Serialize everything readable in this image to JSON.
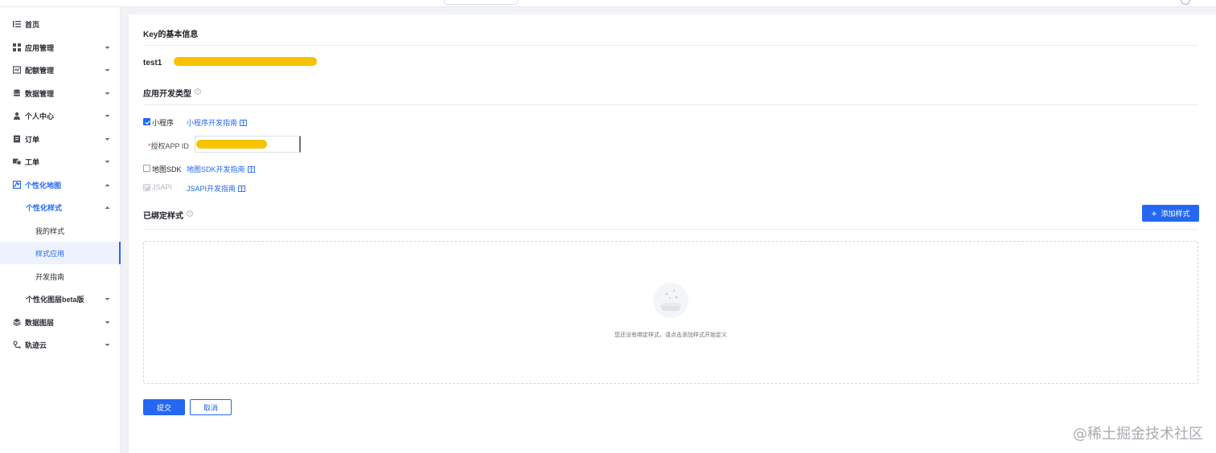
{
  "sidebar": {
    "items": [
      {
        "label": "首页",
        "icon": "list-icon"
      },
      {
        "label": "应用管理",
        "icon": "grid-icon"
      },
      {
        "label": "配额管理",
        "icon": "quota-icon"
      },
      {
        "label": "数据管理",
        "icon": "database-icon"
      },
      {
        "label": "个人中心",
        "icon": "user-icon"
      },
      {
        "label": "订单",
        "icon": "order-icon"
      },
      {
        "label": "工单",
        "icon": "ticket-icon"
      },
      {
        "label": "个性化地图",
        "icon": "map-style-icon"
      },
      {
        "label": "个性化样式"
      },
      {
        "label": "我的样式"
      },
      {
        "label": "样式应用"
      },
      {
        "label": "开发指南"
      },
      {
        "label": "个性化图层beta版"
      },
      {
        "label": "数据图层",
        "icon": "layers-icon"
      },
      {
        "label": "轨迹云",
        "icon": "track-icon"
      }
    ]
  },
  "main": {
    "basic_info_title": "Key的基本信息",
    "key_name": "test1",
    "dev_type_title": "应用开发类型",
    "options": {
      "miniprogram": {
        "label": "小程序",
        "checked": true,
        "guide": "小程序开发指南"
      },
      "appid_label": "授权APP ID",
      "appid_required": "*",
      "mapsdk": {
        "label": "地图SDK",
        "checked": false,
        "guide": "地图SDK开发指南"
      },
      "jsapi": {
        "label": "JSAPI",
        "checked": true,
        "disabled": true,
        "guide": "JSAPI开发指南"
      }
    },
    "bound_styles_title": "已绑定样式",
    "add_style_button": "添加样式",
    "empty_text": "您还没有绑定样式，请点击添加样式开始定义",
    "submit_button": "提交",
    "cancel_button": "取消"
  },
  "watermark": "@稀土掘金技术社区",
  "colors": {
    "accent": "#2468f2",
    "redaction": "#f7c300"
  }
}
